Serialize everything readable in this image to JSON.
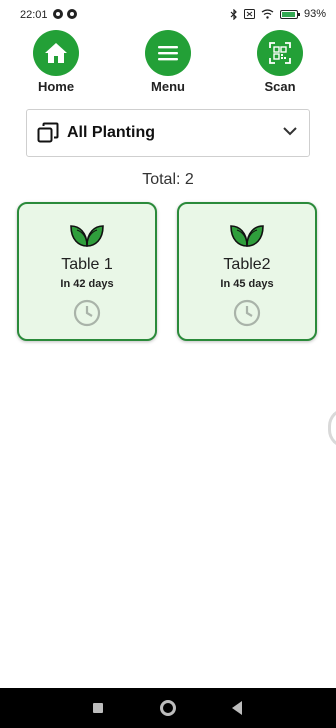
{
  "status_bar": {
    "time": "22:01",
    "battery_text": "93%"
  },
  "nav": {
    "home_label": "Home",
    "menu_label": "Menu",
    "scan_label": "Scan"
  },
  "filter": {
    "selected": "All Planting"
  },
  "total": {
    "text": "Total: 2"
  },
  "cards": [
    {
      "title": "Table 1",
      "subtitle": "In 42 days"
    },
    {
      "title": "Table2",
      "subtitle": "In 45 days"
    }
  ],
  "colors": {
    "primary_green": "#23a037",
    "card_bg": "#e9f7e7",
    "card_border": "#2a8a3a"
  },
  "icons": {
    "home": "home-icon",
    "menu": "hamburger-menu-icon",
    "scan": "qr-scan-icon",
    "dropdown": "copy-stack-icon",
    "leaf": "leaf-icon",
    "clock": "clock-icon"
  }
}
